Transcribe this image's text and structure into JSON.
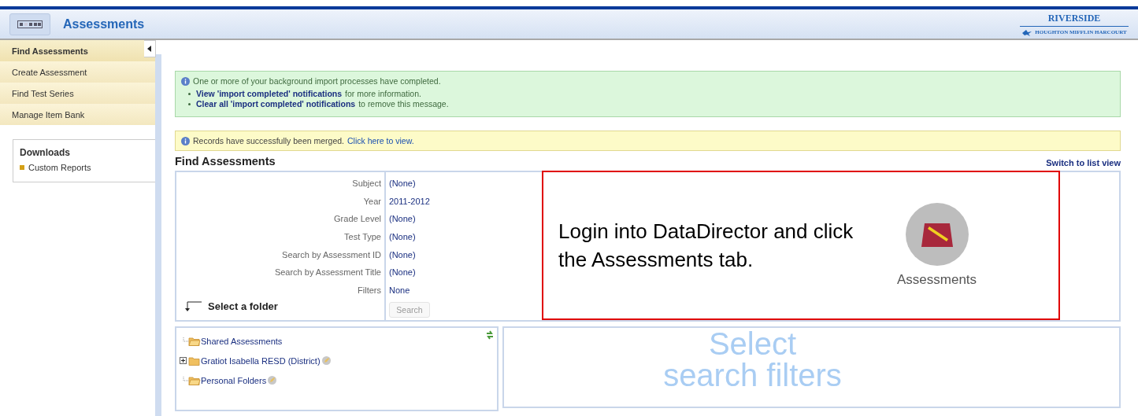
{
  "header": {
    "title": "Assessments",
    "brand": "RIVERSIDE",
    "publisher": "HOUGHTON MIFFLIN HARCOURT"
  },
  "sidebar": {
    "items": [
      {
        "label": "Find Assessments",
        "selected": true
      },
      {
        "label": "Create Assessment",
        "selected": false
      },
      {
        "label": "Find Test Series",
        "selected": false
      },
      {
        "label": "Manage Item Bank",
        "selected": false
      }
    ],
    "downloads": {
      "title": "Downloads",
      "items": [
        "Custom Reports"
      ]
    }
  },
  "notices": [
    {
      "kind": "success",
      "text": "One or more of your background import processes have completed.",
      "bullets": [
        {
          "link": "View 'import completed' notifications",
          "rest": "for more information."
        },
        {
          "link": "Clear all 'import completed' notifications",
          "rest": "to remove this message."
        }
      ]
    },
    {
      "kind": "warning",
      "text": "Records have successfully been merged.",
      "link": "Click here to view."
    }
  ],
  "section": {
    "title": "Find Assessments",
    "switch_link": "Switch to list view"
  },
  "filters": [
    {
      "label": "Subject",
      "value": "(None)"
    },
    {
      "label": "Year",
      "value": "2011-2012"
    },
    {
      "label": "Grade Level",
      "value": "(None)"
    },
    {
      "label": "Test Type",
      "value": "(None)"
    },
    {
      "label": "Search by Assessment ID",
      "value": "(None)"
    },
    {
      "label": "Search by Assessment Title",
      "value": "(None)"
    },
    {
      "label": "Filters",
      "value": "None"
    }
  ],
  "select_folder": "Select a folder",
  "search_button": {
    "label": "Search",
    "disabled": true
  },
  "tree": [
    {
      "label": "Shared Assessments",
      "expandable": false,
      "editable": false
    },
    {
      "label": "Gratiot Isabella RESD (District)",
      "expandable": true,
      "editable": true
    },
    {
      "label": "Personal Folders",
      "expandable": false,
      "editable": true
    }
  ],
  "results_placeholder": [
    "Select",
    "search filters"
  ],
  "callout": {
    "text": "Login into DataDirector and click the Assessments tab.",
    "tab_label": "Assessments"
  }
}
